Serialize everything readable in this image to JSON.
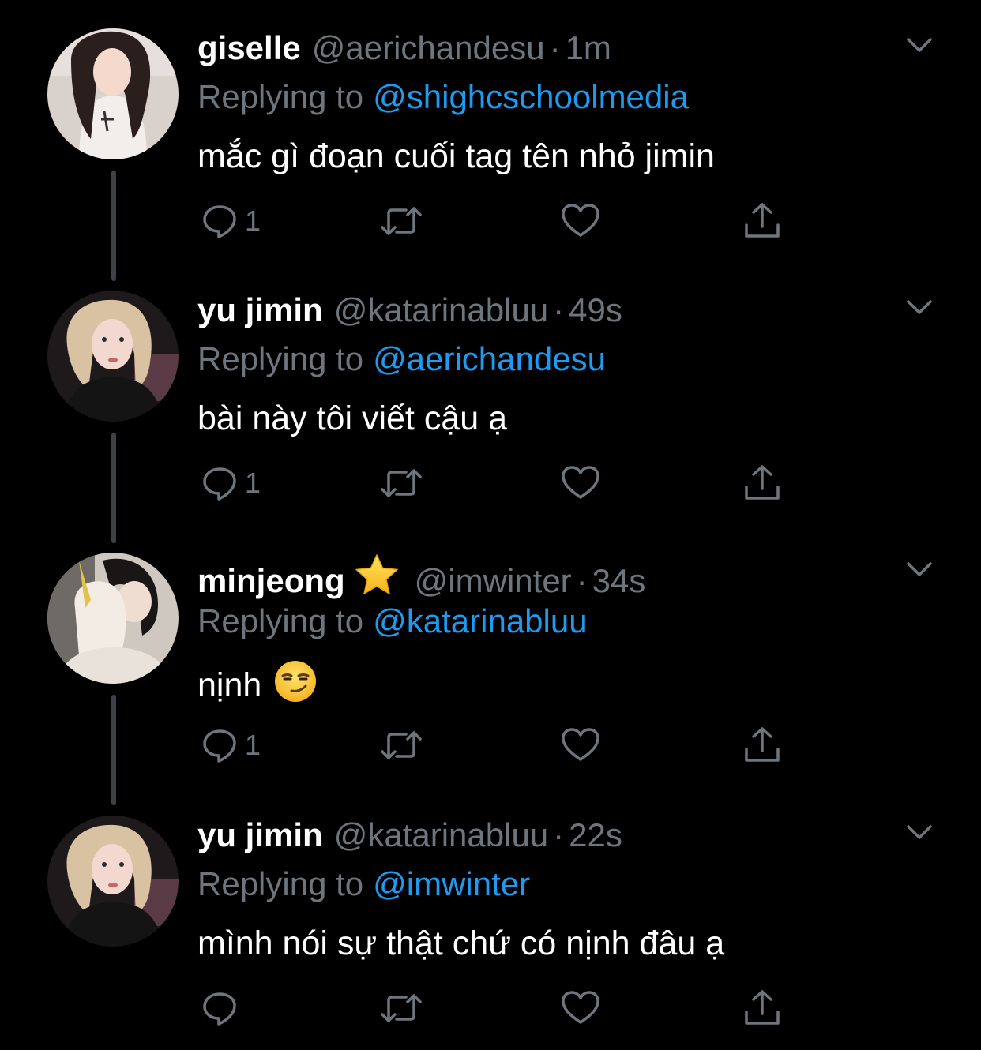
{
  "colors": {
    "background": "#000000",
    "text_primary": "#ffffff",
    "text_secondary": "#6e767d",
    "link": "#1d9bf0",
    "thread_line": "#3d4248"
  },
  "tweets": [
    {
      "display_name": "giselle",
      "badge": "",
      "handle": "@aerichandesu",
      "separator": "·",
      "time": "1m",
      "reply_prefix": "Replying to",
      "reply_to": "@shighcschoolmedia",
      "text": "mắc gì đoạn cuối tag tên nhỏ jimin",
      "emoji": "",
      "reply_count": "1",
      "avatar_icon": "giselle-avatar"
    },
    {
      "display_name": "yu jimin",
      "badge": "",
      "handle": "@katarinabluu",
      "separator": "·",
      "time": "49s",
      "reply_prefix": "Replying to",
      "reply_to": "@aerichandesu",
      "text": "bài này tôi viết cậu ạ",
      "emoji": "",
      "reply_count": "1",
      "avatar_icon": "yujimin-avatar"
    },
    {
      "display_name": "minjeong",
      "badge": "star-emoji",
      "handle": "@imwinter",
      "separator": "·",
      "time": "34s",
      "reply_prefix": "Replying to",
      "reply_to": "@katarinabluu",
      "text": "nịnh",
      "emoji": "smirk-emoji",
      "reply_count": "1",
      "avatar_icon": "minjeong-avatar"
    },
    {
      "display_name": "yu jimin",
      "badge": "",
      "handle": "@katarinabluu",
      "separator": "·",
      "time": "22s",
      "reply_prefix": "Replying to",
      "reply_to": "@imwinter",
      "text": "mình nói sự thật chứ có nịnh đâu ạ",
      "emoji": "",
      "reply_count": "",
      "avatar_icon": "yujimin-avatar"
    }
  ],
  "icons": {
    "reply": "reply-bubble-icon",
    "retweet": "retweet-icon",
    "like": "heart-icon",
    "share": "share-icon",
    "more": "chevron-down-icon"
  }
}
